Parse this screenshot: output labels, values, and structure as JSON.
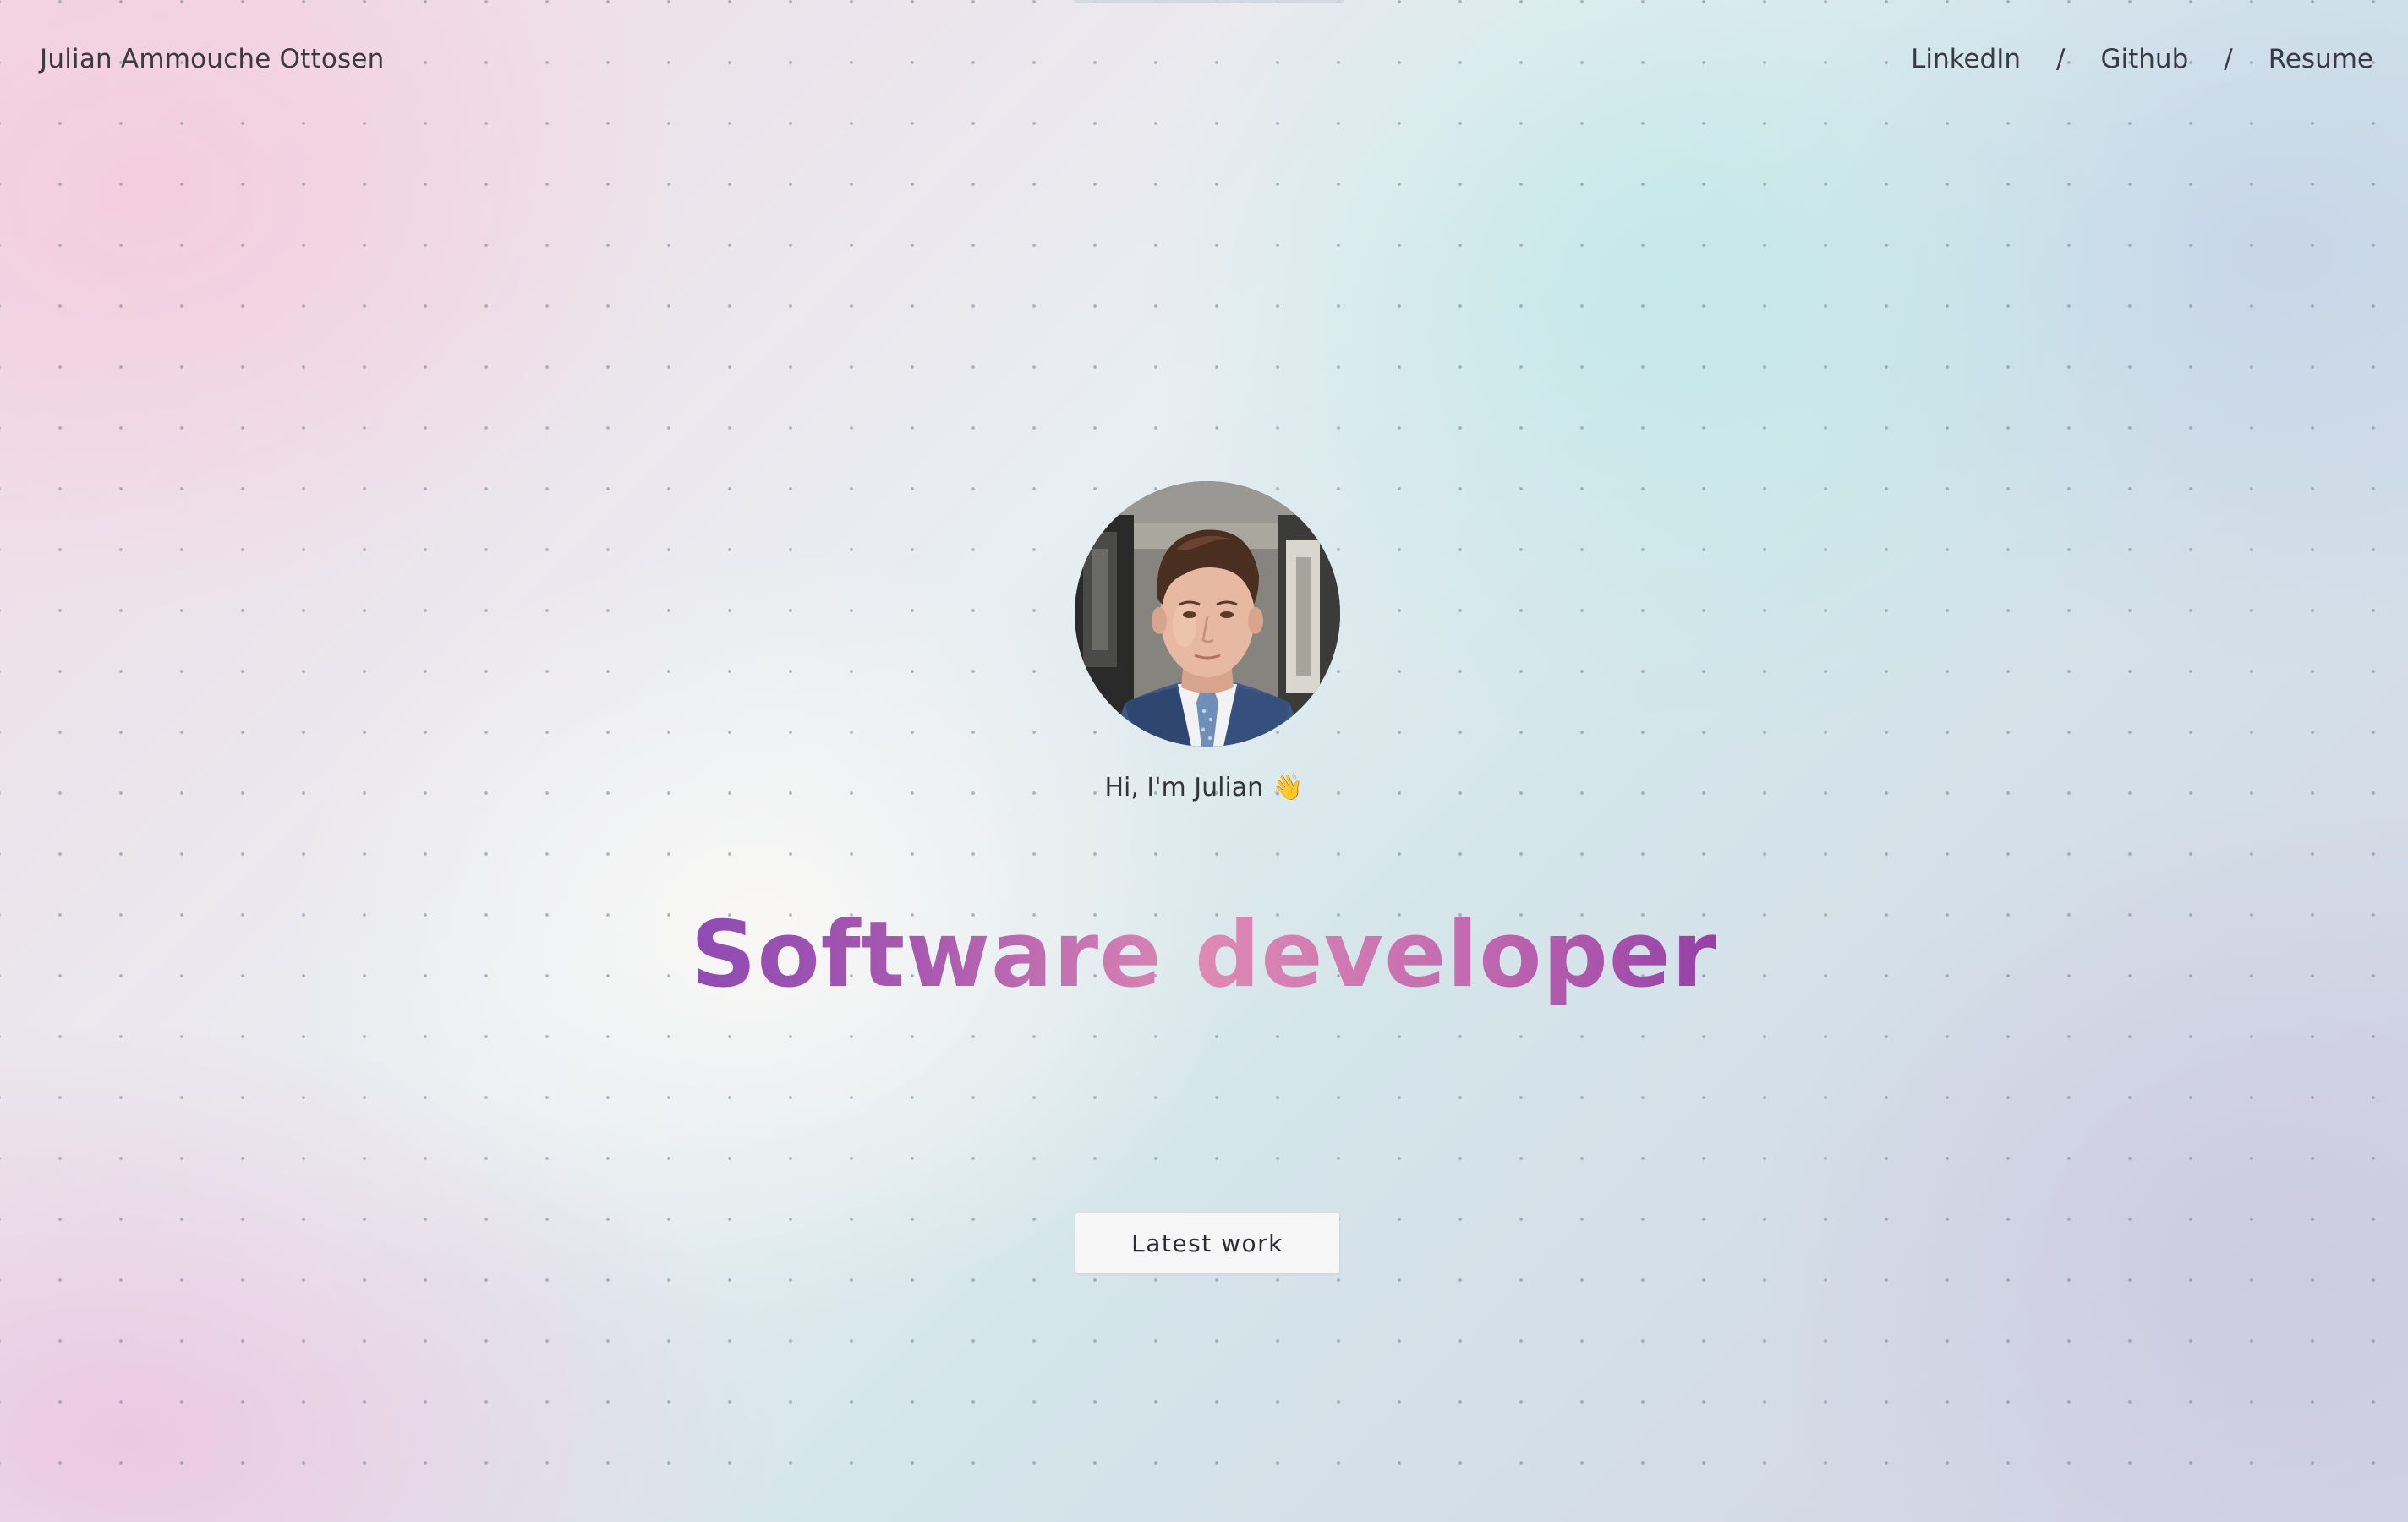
{
  "header": {
    "brand": "Julian Ammouche Ottosen",
    "nav": [
      {
        "label": "LinkedIn"
      },
      {
        "label": "Github"
      },
      {
        "label": "Resume"
      }
    ],
    "separator": "/"
  },
  "hero": {
    "avatar_alt": "Portrait of Julian",
    "greeting": "Hi, I'm Julian",
    "greeting_emoji": "👋",
    "headline": "Software developer",
    "cta_label": "Latest work"
  },
  "colors": {
    "headline_gradient": [
      "#8e4bb2",
      "#de8ab2",
      "#9340a8"
    ],
    "text": "#3a3a42",
    "button_bg": "#f7f6f7"
  }
}
